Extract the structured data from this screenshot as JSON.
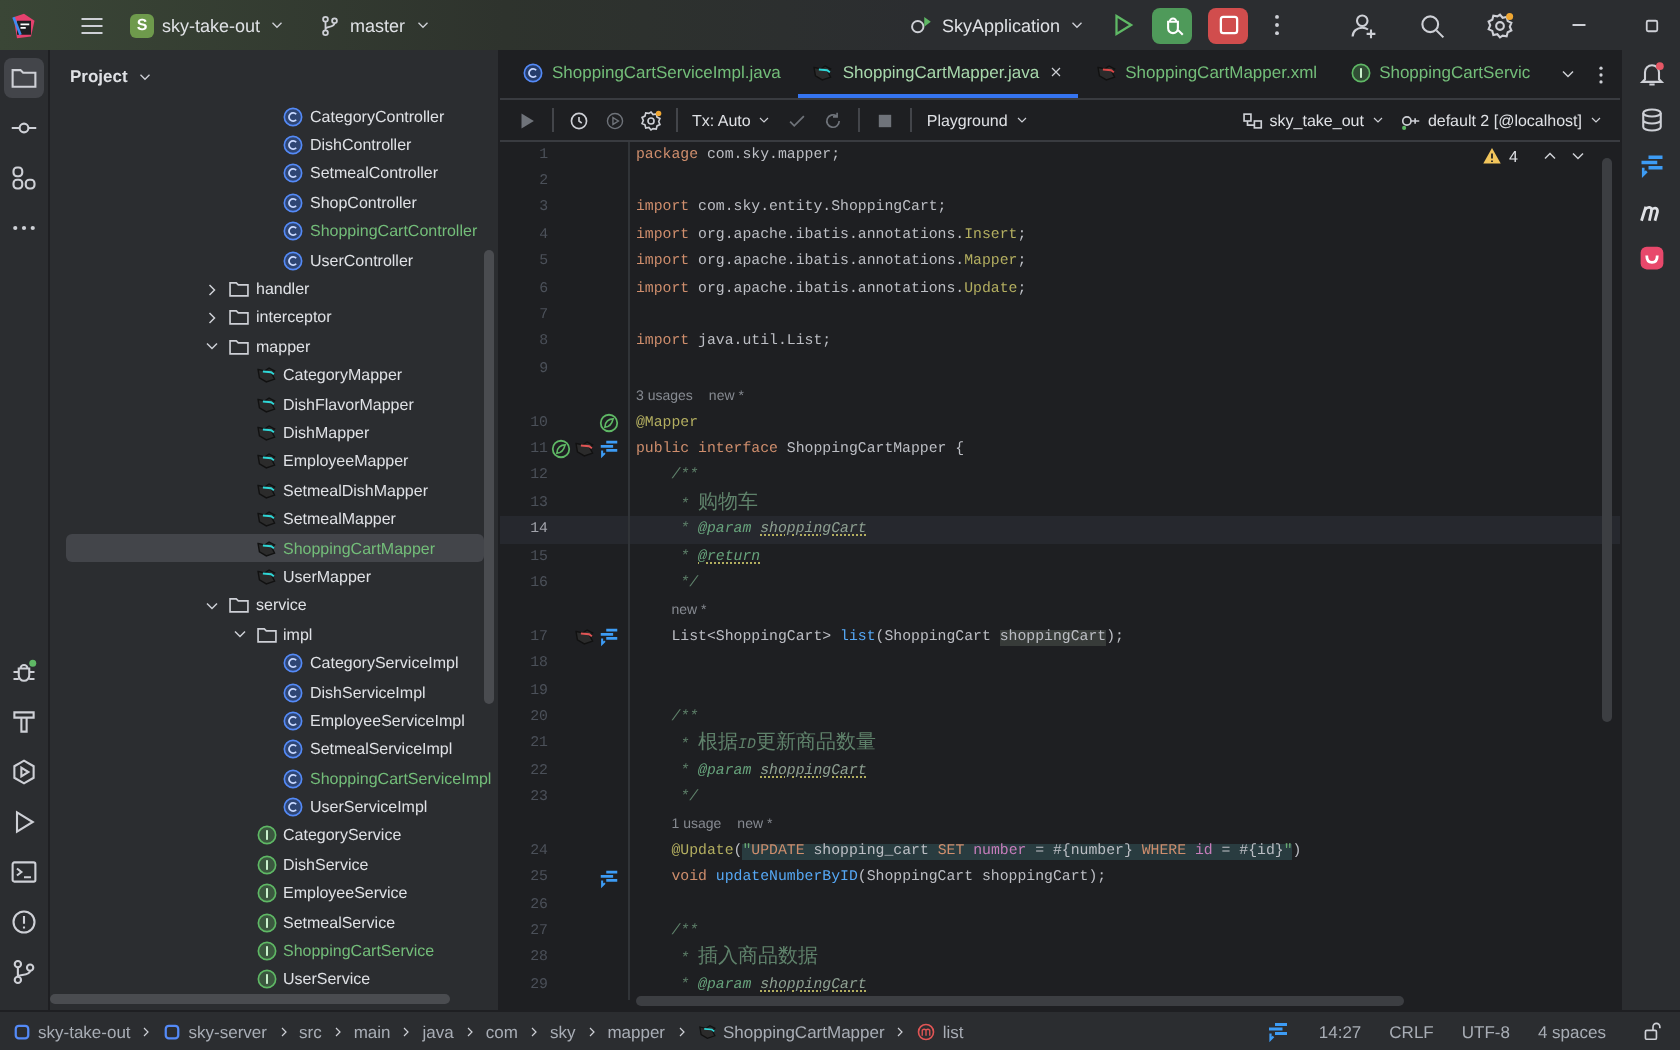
{
  "title_bar": {
    "project_badge": "S",
    "project": "sky-take-out",
    "branch": "master",
    "run_config": "SkyApplication"
  },
  "left_tools": {
    "top": [
      {
        "kind": "folder",
        "selected": true
      },
      {
        "kind": "commit",
        "selected": false
      },
      {
        "kind": "structure",
        "selected": false
      },
      {
        "kind": "more",
        "selected": false
      }
    ],
    "bottom": [
      {
        "kind": "debug",
        "selected": false
      },
      {
        "kind": "hammer",
        "selected": false
      },
      {
        "kind": "services",
        "selected": false
      },
      {
        "kind": "run",
        "selected": false
      },
      {
        "kind": "terminal",
        "selected": false
      },
      {
        "kind": "problems",
        "selected": false
      },
      {
        "kind": "git",
        "selected": false
      }
    ]
  },
  "project_panel": {
    "title": "Project",
    "tree": [
      {
        "children": [
          {
            "children": [
              {
                "kind": "class",
                "label": "CategoryController",
                "added": false,
                "selected": false
              },
              {
                "kind": "class",
                "label": "DishController",
                "added": false,
                "selected": false
              },
              {
                "kind": "class",
                "label": "SetmealController",
                "added": false,
                "selected": false
              },
              {
                "kind": "class",
                "label": "ShopController",
                "added": false,
                "selected": false
              },
              {
                "kind": "class",
                "label": "ShoppingCartController",
                "added": true,
                "selected": false
              },
              {
                "kind": "class",
                "label": "UserController",
                "added": false,
                "selected": false
              }
            ]
          }
        ]
      },
      {
        "kind": "folder",
        "label": "handler",
        "expanded": false,
        "selected": false
      },
      {
        "kind": "folder",
        "label": "interceptor",
        "expanded": false,
        "selected": false
      },
      {
        "kind": "folder",
        "label": "mapper",
        "expanded": true,
        "selected": false,
        "children": [
          {
            "kind": "mapper",
            "label": "CategoryMapper",
            "added": false,
            "selected": false
          },
          {
            "kind": "mapper",
            "label": "DishFlavorMapper",
            "added": false,
            "selected": false
          },
          {
            "kind": "mapper",
            "label": "DishMapper",
            "added": false,
            "selected": false
          },
          {
            "kind": "mapper",
            "label": "EmployeeMapper",
            "added": false,
            "selected": false
          },
          {
            "kind": "mapper",
            "label": "SetmealDishMapper",
            "added": false,
            "selected": false
          },
          {
            "kind": "mapper",
            "label": "SetmealMapper",
            "added": false,
            "selected": false
          },
          {
            "kind": "mapper",
            "label": "ShoppingCartMapper",
            "added": true,
            "selected": true
          },
          {
            "kind": "mapper",
            "label": "UserMapper",
            "added": false,
            "selected": false
          }
        ]
      },
      {
        "kind": "folder",
        "label": "service",
        "expanded": true,
        "selected": false,
        "children": [
          {
            "kind": "folder",
            "label": "impl",
            "expanded": true,
            "selected": false,
            "children": [
              {
                "kind": "class",
                "label": "CategoryServiceImpl",
                "added": false,
                "selected": false
              },
              {
                "kind": "class",
                "label": "DishServiceImpl",
                "added": false,
                "selected": false
              },
              {
                "kind": "class",
                "label": "EmployeeServiceImpl",
                "added": false,
                "selected": false
              },
              {
                "kind": "class",
                "label": "SetmealServiceImpl",
                "added": false,
                "selected": false
              },
              {
                "kind": "class",
                "label": "ShoppingCartServiceImpl",
                "added": true,
                "selected": false
              },
              {
                "kind": "class",
                "label": "UserServiceImpl",
                "added": false,
                "selected": false
              }
            ]
          },
          {
            "kind": "interface",
            "label": "CategoryService",
            "added": false,
            "selected": false
          },
          {
            "kind": "interface",
            "label": "DishService",
            "added": false,
            "selected": false
          },
          {
            "kind": "interface",
            "label": "EmployeeService",
            "added": false,
            "selected": false
          },
          {
            "kind": "interface",
            "label": "SetmealService",
            "added": false,
            "selected": false
          },
          {
            "kind": "interface",
            "label": "ShoppingCartService",
            "added": true,
            "selected": false
          },
          {
            "kind": "interface",
            "label": "UserService",
            "added": false,
            "selected": false
          }
        ]
      }
    ]
  },
  "editor": {
    "tabs": [
      {
        "kind": "class",
        "label": "ShoppingCartServiceImpl.java",
        "added": true,
        "selected": false
      },
      {
        "kind": "mapper",
        "label": "ShoppingCartMapper.java",
        "added": true,
        "selected": true
      },
      {
        "kind": "xml",
        "label": "ShoppingCartMapper.xml",
        "added": true,
        "selected": false
      },
      {
        "kind": "interface",
        "label": "ShoppingCartServic",
        "added": true,
        "selected": false
      }
    ],
    "toolbar": {
      "tx_mode": "Tx: Auto",
      "console": "Playground",
      "schema": "sky_take_out",
      "data_source": "default 2 [@localhost]"
    },
    "warnings": "4",
    "lines": [
      {
        "number": "1",
        "current": false,
        "tokens": [
          {
            "kind": "keyword",
            "text": "package"
          },
          {
            "kind": "plain",
            "text": " com.sky.mapper;"
          }
        ]
      },
      {
        "number": "2",
        "current": false
      },
      {
        "number": "3",
        "current": false,
        "tokens": [
          {
            "kind": "keyword",
            "text": "import"
          },
          {
            "kind": "plain",
            "text": " com.sky.entity.ShoppingCart;"
          }
        ]
      },
      {
        "number": "4",
        "current": false,
        "tokens": [
          {
            "kind": "keyword",
            "text": "import"
          },
          {
            "kind": "plain",
            "text": " org.apache.ibatis.annotations."
          },
          {
            "kind": "annotation",
            "text": "Insert"
          },
          {
            "kind": "plain",
            "text": ";"
          }
        ]
      },
      {
        "number": "5",
        "current": false,
        "tokens": [
          {
            "kind": "keyword",
            "text": "import"
          },
          {
            "kind": "plain",
            "text": " org.apache.ibatis.annotations."
          },
          {
            "kind": "annotation",
            "text": "Mapper"
          },
          {
            "kind": "plain",
            "text": ";"
          }
        ]
      },
      {
        "number": "6",
        "current": false,
        "tokens": [
          {
            "kind": "keyword",
            "text": "import"
          },
          {
            "kind": "plain",
            "text": " org.apache.ibatis.annotations."
          },
          {
            "kind": "annotation",
            "text": "Update"
          },
          {
            "kind": "plain",
            "text": ";"
          }
        ]
      },
      {
        "number": "7",
        "current": false
      },
      {
        "number": "8",
        "current": false,
        "tokens": [
          {
            "kind": "keyword",
            "text": "import"
          },
          {
            "kind": "plain",
            "text": " java.util.List;"
          }
        ]
      },
      {
        "number": "9",
        "current": false
      },
      {
        "number": "10",
        "current": false,
        "hint": {
          "usages": "3 usages",
          "author": "new *"
        },
        "gutter": [
          {
            "kind": "bean"
          }
        ],
        "tokens": [
          {
            "kind": "annotation",
            "text": "@Mapper"
          }
        ]
      },
      {
        "number": "11",
        "current": false,
        "gutter": [
          {
            "kind": "bean"
          },
          {
            "kind": "mapper"
          },
          {
            "kind": "jump"
          }
        ],
        "tokens": [
          {
            "kind": "keyword",
            "text": "public interface"
          },
          {
            "kind": "plain",
            "text": " ShoppingCartMapper {"
          }
        ]
      },
      {
        "number": "12",
        "current": false,
        "tokens": [
          {
            "kind": "doc",
            "text": "    /**"
          }
        ]
      },
      {
        "number": "13",
        "current": false,
        "tokens": [
          {
            "kind": "doc",
            "text": "     * 购物车"
          }
        ]
      },
      {
        "number": "14",
        "current": true,
        "tokens": [
          {
            "kind": "doc",
            "text": "     * "
          },
          {
            "kind": "doctag",
            "text": "@param "
          },
          {
            "kind": "docref",
            "text": "shoppingCart"
          }
        ]
      },
      {
        "number": "15",
        "current": false,
        "tokens": [
          {
            "kind": "doc",
            "text": "     * "
          },
          {
            "kind": "warntag",
            "text": "@return"
          }
        ]
      },
      {
        "number": "16",
        "current": false,
        "tokens": [
          {
            "kind": "doc",
            "text": "     */"
          }
        ]
      },
      {
        "number": "17",
        "current": false,
        "hint": {
          "author": "new *"
        },
        "gutter": [
          {
            "kind": "mapper"
          },
          {
            "kind": "jump"
          }
        ],
        "tokens": [
          {
            "kind": "plain",
            "text": "    List<ShoppingCart> "
          },
          {
            "kind": "fn",
            "text": "list"
          },
          {
            "kind": "plain",
            "text": "(ShoppingCart "
          },
          {
            "kind": "ref",
            "text": "shoppingCart"
          },
          {
            "kind": "plain",
            "text": ");"
          }
        ]
      },
      {
        "number": "18",
        "current": false
      },
      {
        "number": "19",
        "current": false
      },
      {
        "number": "20",
        "current": false,
        "tokens": [
          {
            "kind": "doc",
            "text": "    /**"
          }
        ]
      },
      {
        "number": "21",
        "current": false,
        "tokens": [
          {
            "kind": "doc",
            "text": "     * 根据ID更新商品数量"
          }
        ]
      },
      {
        "number": "22",
        "current": false,
        "tokens": [
          {
            "kind": "doc",
            "text": "     * "
          },
          {
            "kind": "doctag",
            "text": "@param "
          },
          {
            "kind": "docref",
            "text": "shoppingCart"
          }
        ]
      },
      {
        "number": "23",
        "current": false,
        "tokens": [
          {
            "kind": "doc",
            "text": "     */"
          }
        ]
      },
      {
        "number": "24",
        "current": false,
        "hint": {
          "usages": "1 usage",
          "author": "new *"
        },
        "tokens": [
          {
            "kind": "annotation",
            "text": "    @Update"
          },
          {
            "kind": "plain",
            "text": "("
          },
          {
            "kind": "string",
            "text": "\""
          },
          {
            "kind": "sqlkw",
            "text": "UPDATE"
          },
          {
            "kind": "sql",
            "text": " shopping_cart "
          },
          {
            "kind": "sqlkw",
            "text": "SET"
          },
          {
            "kind": "sqlcol",
            "text": " number"
          },
          {
            "kind": "sql",
            "text": " = #{number} "
          },
          {
            "kind": "sqlkw",
            "text": "WHERE"
          },
          {
            "kind": "sqlcol",
            "text": " id"
          },
          {
            "kind": "sql",
            "text": " = #{id}"
          },
          {
            "kind": "string",
            "text": "\""
          },
          {
            "kind": "plain",
            "text": ")"
          }
        ]
      },
      {
        "number": "25",
        "current": false,
        "gutter": [
          {
            "kind": "jump"
          }
        ],
        "tokens": [
          {
            "kind": "keyword",
            "text": "    void "
          },
          {
            "kind": "fn",
            "text": "updateNumberByID"
          },
          {
            "kind": "plain",
            "text": "(ShoppingCart shoppingCart);"
          }
        ]
      },
      {
        "number": "26",
        "current": false
      },
      {
        "number": "27",
        "current": false,
        "tokens": [
          {
            "kind": "doc",
            "text": "    /**"
          }
        ]
      },
      {
        "number": "28",
        "current": false,
        "tokens": [
          {
            "kind": "doc",
            "text": "     * 插入商品数据"
          }
        ]
      },
      {
        "number": "29",
        "current": false,
        "tokens": [
          {
            "kind": "doc",
            "text": "     * "
          },
          {
            "kind": "doctag",
            "text": "@param "
          },
          {
            "kind": "docref",
            "text": "shoppingCart"
          }
        ]
      }
    ]
  },
  "right_tools": [
    {
      "kind": "bell"
    },
    {
      "kind": "database"
    },
    {
      "kind": "jump"
    },
    {
      "kind": "letter-m"
    },
    {
      "kind": "app"
    }
  ],
  "status_bar": {
    "breadcrumbs": [
      {
        "kind": "module",
        "label": "sky-take-out"
      },
      {
        "kind": "module",
        "label": "sky-server"
      },
      {
        "kind": "plain",
        "label": "src"
      },
      {
        "kind": "plain",
        "label": "main"
      },
      {
        "kind": "plain",
        "label": "java"
      },
      {
        "kind": "plain",
        "label": "com"
      },
      {
        "kind": "plain",
        "label": "sky"
      },
      {
        "kind": "plain",
        "label": "mapper"
      },
      {
        "kind": "mapper",
        "label": "ShoppingCartMapper"
      },
      {
        "kind": "method",
        "label": "list"
      }
    ],
    "position": "14:27",
    "line_ending": "CRLF",
    "encoding": "UTF-8",
    "indent": "4 spaces"
  }
}
